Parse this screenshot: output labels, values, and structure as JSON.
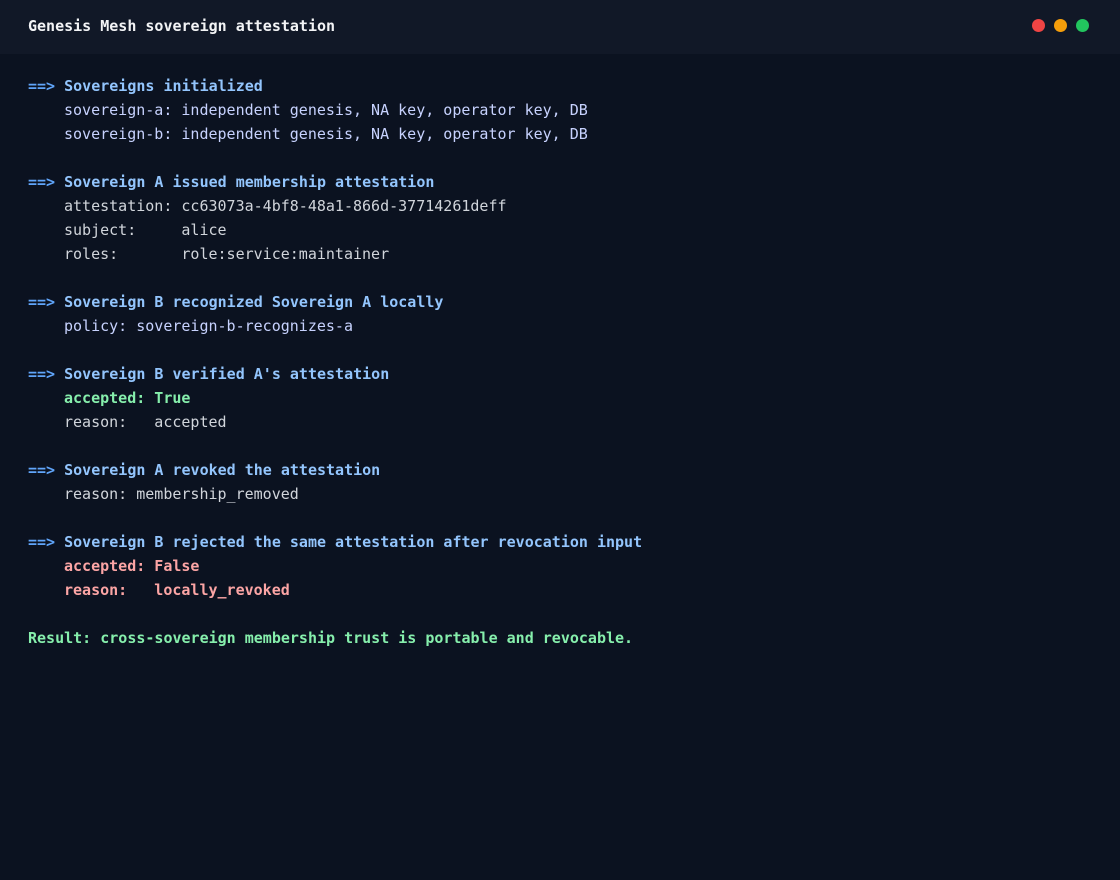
{
  "window": {
    "title": "Genesis Mesh sovereign attestation"
  },
  "terminal": {
    "prompt_arrow": "==>",
    "sections": [
      {
        "heading": "Sovereigns initialized",
        "lines": [
          "sovereign-a: independent genesis, NA key, operator key, DB",
          "sovereign-b: independent genesis, NA key, operator key, DB"
        ]
      },
      {
        "heading": "Sovereign A issued membership attestation",
        "lines": [
          "attestation: cc63073a-4bf8-48a1-866d-37714261deff",
          "subject:     alice",
          "roles:       role:service:maintainer"
        ]
      },
      {
        "heading": "Sovereign B recognized Sovereign A locally",
        "lines": [
          "policy: sovereign-b-recognizes-a"
        ]
      },
      {
        "heading": "Sovereign B verified A's attestation",
        "lines": [
          "accepted: True",
          "reason:   accepted"
        ]
      },
      {
        "heading": "Sovereign A revoked the attestation",
        "lines": [
          "reason: membership_removed"
        ]
      },
      {
        "heading": "Sovereign B rejected the same attestation after revocation input",
        "lines": [
          "accepted: False",
          "reason:   locally_revoked"
        ]
      }
    ],
    "result": "Result: cross-sovereign membership trust is portable and revocable."
  },
  "colors": {
    "background": "#0b1220",
    "titlebar": "#111827",
    "heading": "#93c5fd",
    "success": "#86efac",
    "error": "#fca5a5",
    "close": "#ef4444",
    "minimize": "#f59e0b",
    "maximize": "#22c55e"
  },
  "icons": {
    "close": "close-dot-icon",
    "minimize": "minimize-dot-icon",
    "maximize": "maximize-dot-icon"
  }
}
